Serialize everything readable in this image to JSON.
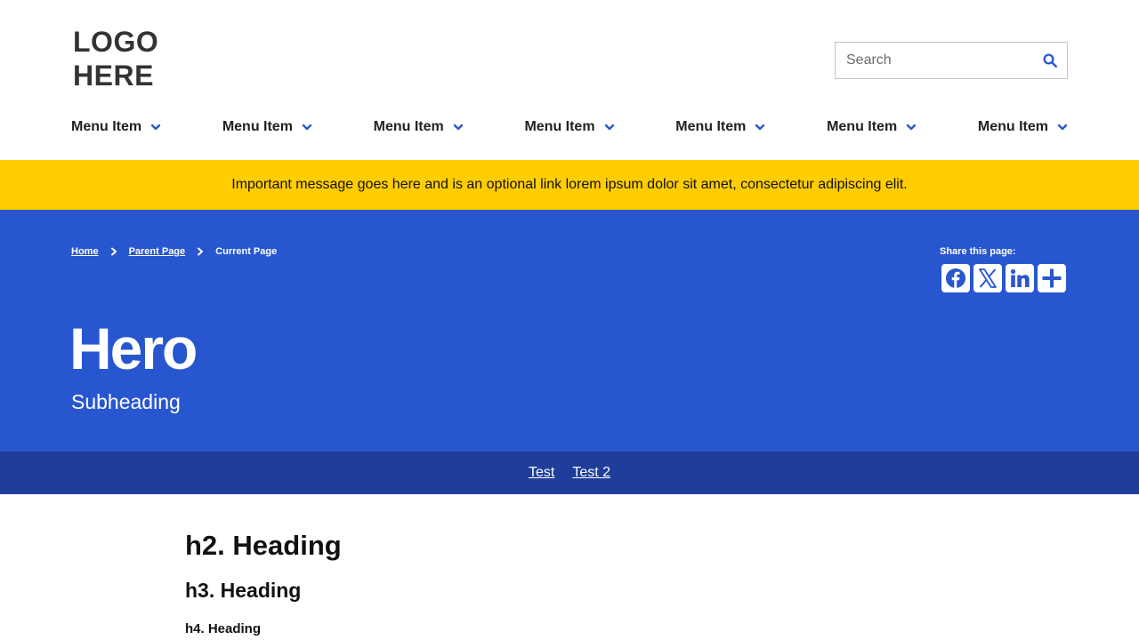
{
  "header": {
    "logo": "LOGO HERE",
    "search": {
      "placeholder": "Search",
      "value": "",
      "icon": "search-icon"
    },
    "nav": [
      {
        "label": "Menu Item",
        "icon": "chevron-down-icon"
      },
      {
        "label": "Menu Item",
        "icon": "chevron-down-icon"
      },
      {
        "label": "Menu Item",
        "icon": "chevron-down-icon"
      },
      {
        "label": "Menu Item",
        "icon": "chevron-down-icon"
      },
      {
        "label": "Menu Item",
        "icon": "chevron-down-icon"
      },
      {
        "label": "Menu Item",
        "icon": "chevron-down-icon"
      },
      {
        "label": "Menu Item",
        "icon": "chevron-down-icon"
      }
    ]
  },
  "alert": {
    "message": "Important message goes here and is an optional link lorem ipsum dolor sit amet, consectetur adipiscing elit.",
    "background": "#ffcd00"
  },
  "hero": {
    "background": "#2856cf",
    "breadcrumb": {
      "home": "Home",
      "parent": "Parent Page",
      "current": "Current Page"
    },
    "share": {
      "label": "Share this page:",
      "buttons": [
        "facebook-icon",
        "x-icon",
        "linkedin-icon",
        "plus-icon"
      ]
    },
    "title": "Hero",
    "subtitle": "Subheading"
  },
  "subnav": {
    "background": "#1f3e9c",
    "links": [
      "Test",
      "Test 2"
    ]
  },
  "content": {
    "h2": "h2. Heading",
    "h3": "h3. Heading",
    "h4": "h4. Heading"
  },
  "colors": {
    "accent": "#2856cf",
    "text": "#222222"
  }
}
